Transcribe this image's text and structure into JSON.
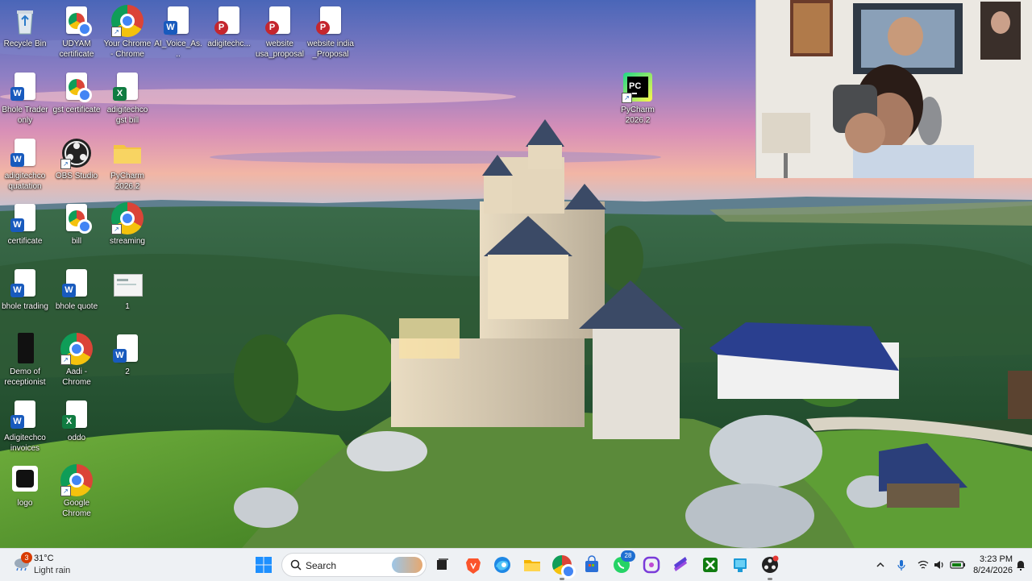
{
  "desktop": {
    "icons": [
      {
        "label": "Recycle Bin",
        "icon": "recycle-bin-icon"
      },
      {
        "label": "UDYAM certificate",
        "icon": "pdf-icon"
      },
      {
        "label": "Your Chrome - Chrome",
        "icon": "chrome-icon"
      },
      {
        "label": "AI_Voice_As...",
        "icon": "word-icon"
      },
      {
        "label": "adigitechc...",
        "icon": "powerpoint-icon"
      },
      {
        "label": "website usa_proposal",
        "icon": "powerpoint-icon"
      },
      {
        "label": "website india _Proposal",
        "icon": "powerpoint-icon"
      },
      {
        "label": "Bhole Trader only",
        "icon": "word-icon"
      },
      {
        "label": "gst certificate",
        "icon": "pdf-icon"
      },
      {
        "label": "adigitechco gst bill",
        "icon": "excel-icon"
      },
      {
        "label": "adigitechco quatation",
        "icon": "word-icon"
      },
      {
        "label": "OBS Studio",
        "icon": "obs-icon"
      },
      {
        "label": "PyCharm 2026.2",
        "icon": "folder-icon"
      },
      {
        "label": "certificate",
        "icon": "word-icon"
      },
      {
        "label": "bill",
        "icon": "pdf-icon"
      },
      {
        "label": "streaming",
        "icon": "chrome-icon"
      },
      {
        "label": "bhole trading",
        "icon": "word-icon"
      },
      {
        "label": "bhole quote",
        "icon": "word-icon"
      },
      {
        "label": "1",
        "icon": "image-icon"
      },
      {
        "label": "Demo of receptionist",
        "icon": "video-file-icon"
      },
      {
        "label": "Aadi - Chrome",
        "icon": "chrome-icon"
      },
      {
        "label": "2",
        "icon": "word-icon"
      },
      {
        "label": "Adigitechco invoices",
        "icon": "word-icon"
      },
      {
        "label": "oddo",
        "icon": "excel-icon"
      },
      {
        "label": "logo",
        "icon": "logo-file-icon"
      },
      {
        "label": "Google Chrome",
        "icon": "chrome-icon"
      },
      {
        "label": "PyCharm 2026.2",
        "icon": "pycharm-icon"
      }
    ]
  },
  "taskbar": {
    "weather": {
      "temp": "31°C",
      "condition": "Light rain",
      "badge": "3"
    },
    "search_placeholder": "Search",
    "apps": [
      {
        "name": "task-view",
        "icon": "task-view-icon"
      },
      {
        "name": "brave",
        "icon": "brave-icon"
      },
      {
        "name": "edge",
        "icon": "edge-icon"
      },
      {
        "name": "file-explorer",
        "icon": "folder-icon"
      },
      {
        "name": "chrome",
        "icon": "chrome-icon"
      },
      {
        "name": "store",
        "icon": "store-icon"
      },
      {
        "name": "whatsapp",
        "icon": "whatsapp-icon",
        "badge": "28"
      },
      {
        "name": "copilot",
        "icon": "copilot-icon"
      },
      {
        "name": "stack-app",
        "icon": "stack-icon"
      },
      {
        "name": "xbox",
        "icon": "xbox-icon"
      },
      {
        "name": "app-blue",
        "icon": "app-icon"
      },
      {
        "name": "obs",
        "icon": "obs-icon"
      }
    ],
    "clock": {
      "time": "3:23 PM",
      "date": "8/24/2026"
    }
  },
  "colors": {
    "taskbar_bg": "#eef1f4",
    "accent": "#1f6fd1"
  }
}
